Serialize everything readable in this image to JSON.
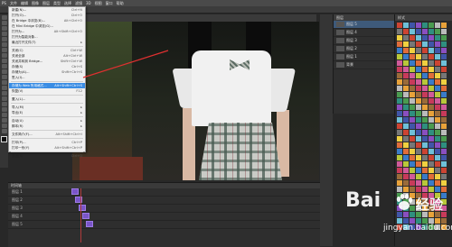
{
  "menubar": {
    "items": [
      "PS",
      "文件",
      "编辑",
      "图像",
      "图层",
      "类型",
      "选择",
      "滤镜",
      "3D",
      "视图",
      "窗口",
      "帮助"
    ]
  },
  "file_menu": {
    "rows": [
      {
        "label": "新建(N)...",
        "shortcut": "Ctrl+N"
      },
      {
        "label": "打开(O)...",
        "shortcut": "Ctrl+O"
      },
      {
        "label": "在 Bridge 中浏览(B)...",
        "shortcut": "Alt+Ctrl+O"
      },
      {
        "label": "在 Mini Bridge 中浏览(G)...",
        "shortcut": ""
      },
      {
        "label": "打开为...",
        "shortcut": "Alt+Shift+Ctrl+O"
      },
      {
        "label": "打开为智能对象...",
        "shortcut": ""
      },
      {
        "label": "最近打开文件(T)",
        "shortcut": "▸"
      },
      {
        "sep": true
      },
      {
        "label": "关闭(C)",
        "shortcut": "Ctrl+W"
      },
      {
        "label": "关闭全部",
        "shortcut": "Alt+Ctrl+W"
      },
      {
        "label": "关闭并转到 Bridge...",
        "shortcut": "Shift+Ctrl+W"
      },
      {
        "label": "存储(S)",
        "shortcut": "Ctrl+S"
      },
      {
        "label": "存储为(A)...",
        "shortcut": "Shift+Ctrl+S"
      },
      {
        "label": "签入(I)...",
        "shortcut": ""
      },
      {
        "sep": true
      },
      {
        "label": "存储为 Web 所用格式...",
        "shortcut": "Alt+Shift+Ctrl+S",
        "highlight": true
      },
      {
        "label": "恢复(V)",
        "shortcut": "F12"
      },
      {
        "sep": true
      },
      {
        "label": "置入(L)...",
        "shortcut": ""
      },
      {
        "sep": true
      },
      {
        "label": "导入(M)",
        "shortcut": "▸"
      },
      {
        "label": "导出(E)",
        "shortcut": "▸"
      },
      {
        "sep": true
      },
      {
        "label": "自动(U)",
        "shortcut": "▸"
      },
      {
        "label": "脚本(R)",
        "shortcut": "▸"
      },
      {
        "sep": true
      },
      {
        "label": "文件简介(F)...",
        "shortcut": "Alt+Shift+Ctrl+I"
      },
      {
        "sep": true
      },
      {
        "label": "打印(P)...",
        "shortcut": "Ctrl+P"
      },
      {
        "label": "打印一份(Y)",
        "shortcut": "Alt+Shift+Ctrl+P"
      },
      {
        "sep": true
      },
      {
        "label": "退出(X)",
        "shortcut": "Ctrl+Q"
      }
    ]
  },
  "timeline": {
    "title": "时间轴",
    "tracks": [
      "图层 1",
      "图层 2",
      "图层 3",
      "图层 4",
      "图层 5"
    ]
  },
  "layers_panel": {
    "tab": "图层",
    "rows": [
      "图层 5",
      "图层 4",
      "图层 3",
      "图层 2",
      "图层 1",
      "背景"
    ]
  },
  "swatches_panel": {
    "tab": "样式"
  },
  "watermark": {
    "brand": "Bai",
    "cn": "经验",
    "url": "jingyan.baidu.com"
  },
  "colors": {
    "menu_highlight": "#3a8de4",
    "clip": "#7a55c8",
    "annotation_line": "#e03030"
  }
}
